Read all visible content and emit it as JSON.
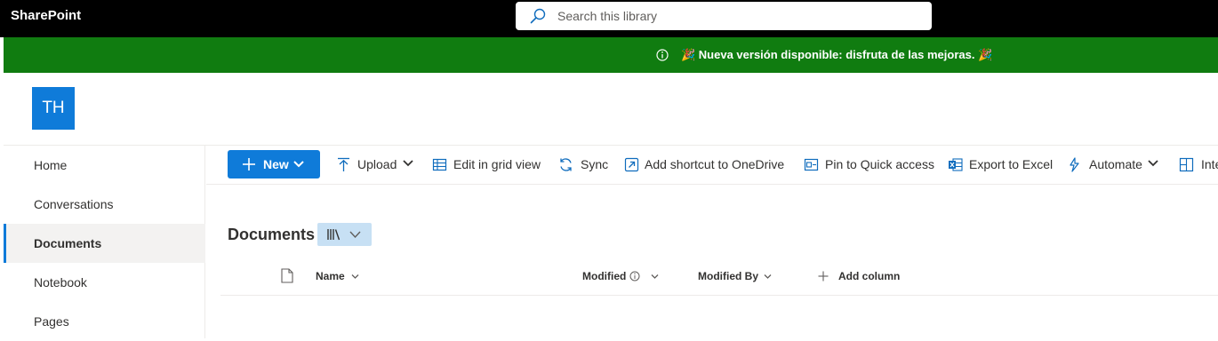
{
  "app": {
    "brand": "SharePoint"
  },
  "search": {
    "placeholder": "Search this library"
  },
  "banner": {
    "message": "🎉 Nueva versión disponible: disfruta de las mejoras. 🎉"
  },
  "site": {
    "logo_initials": "TH",
    "logo_color": "#0f7bd9"
  },
  "nav": {
    "items": [
      {
        "label": "Home"
      },
      {
        "label": "Conversations"
      },
      {
        "label": "Documents",
        "active": true
      },
      {
        "label": "Notebook"
      },
      {
        "label": "Pages"
      }
    ]
  },
  "commands": {
    "new": "New",
    "upload": "Upload",
    "edit_grid": "Edit in grid view",
    "sync": "Sync",
    "add_shortcut": "Add shortcut to OneDrive",
    "pin": "Pin to Quick access",
    "export": "Export to Excel",
    "automate": "Automate",
    "integrate": "Integrate"
  },
  "library": {
    "title": "Documents"
  },
  "columns": {
    "name": "Name",
    "modified": "Modified",
    "modified_by": "Modified By",
    "add_column": "Add column"
  },
  "colors": {
    "accent": "#0f7bd9",
    "banner": "#107c10",
    "topbar": "#000000"
  },
  "icons": [
    "search-icon",
    "info-icon",
    "plus-icon",
    "chevron-down-icon",
    "upload-icon",
    "grid-icon",
    "sync-icon",
    "shortcut-icon",
    "pin-icon",
    "excel-icon",
    "automate-icon",
    "integrate-icon",
    "library-view-icon",
    "document-icon"
  ]
}
